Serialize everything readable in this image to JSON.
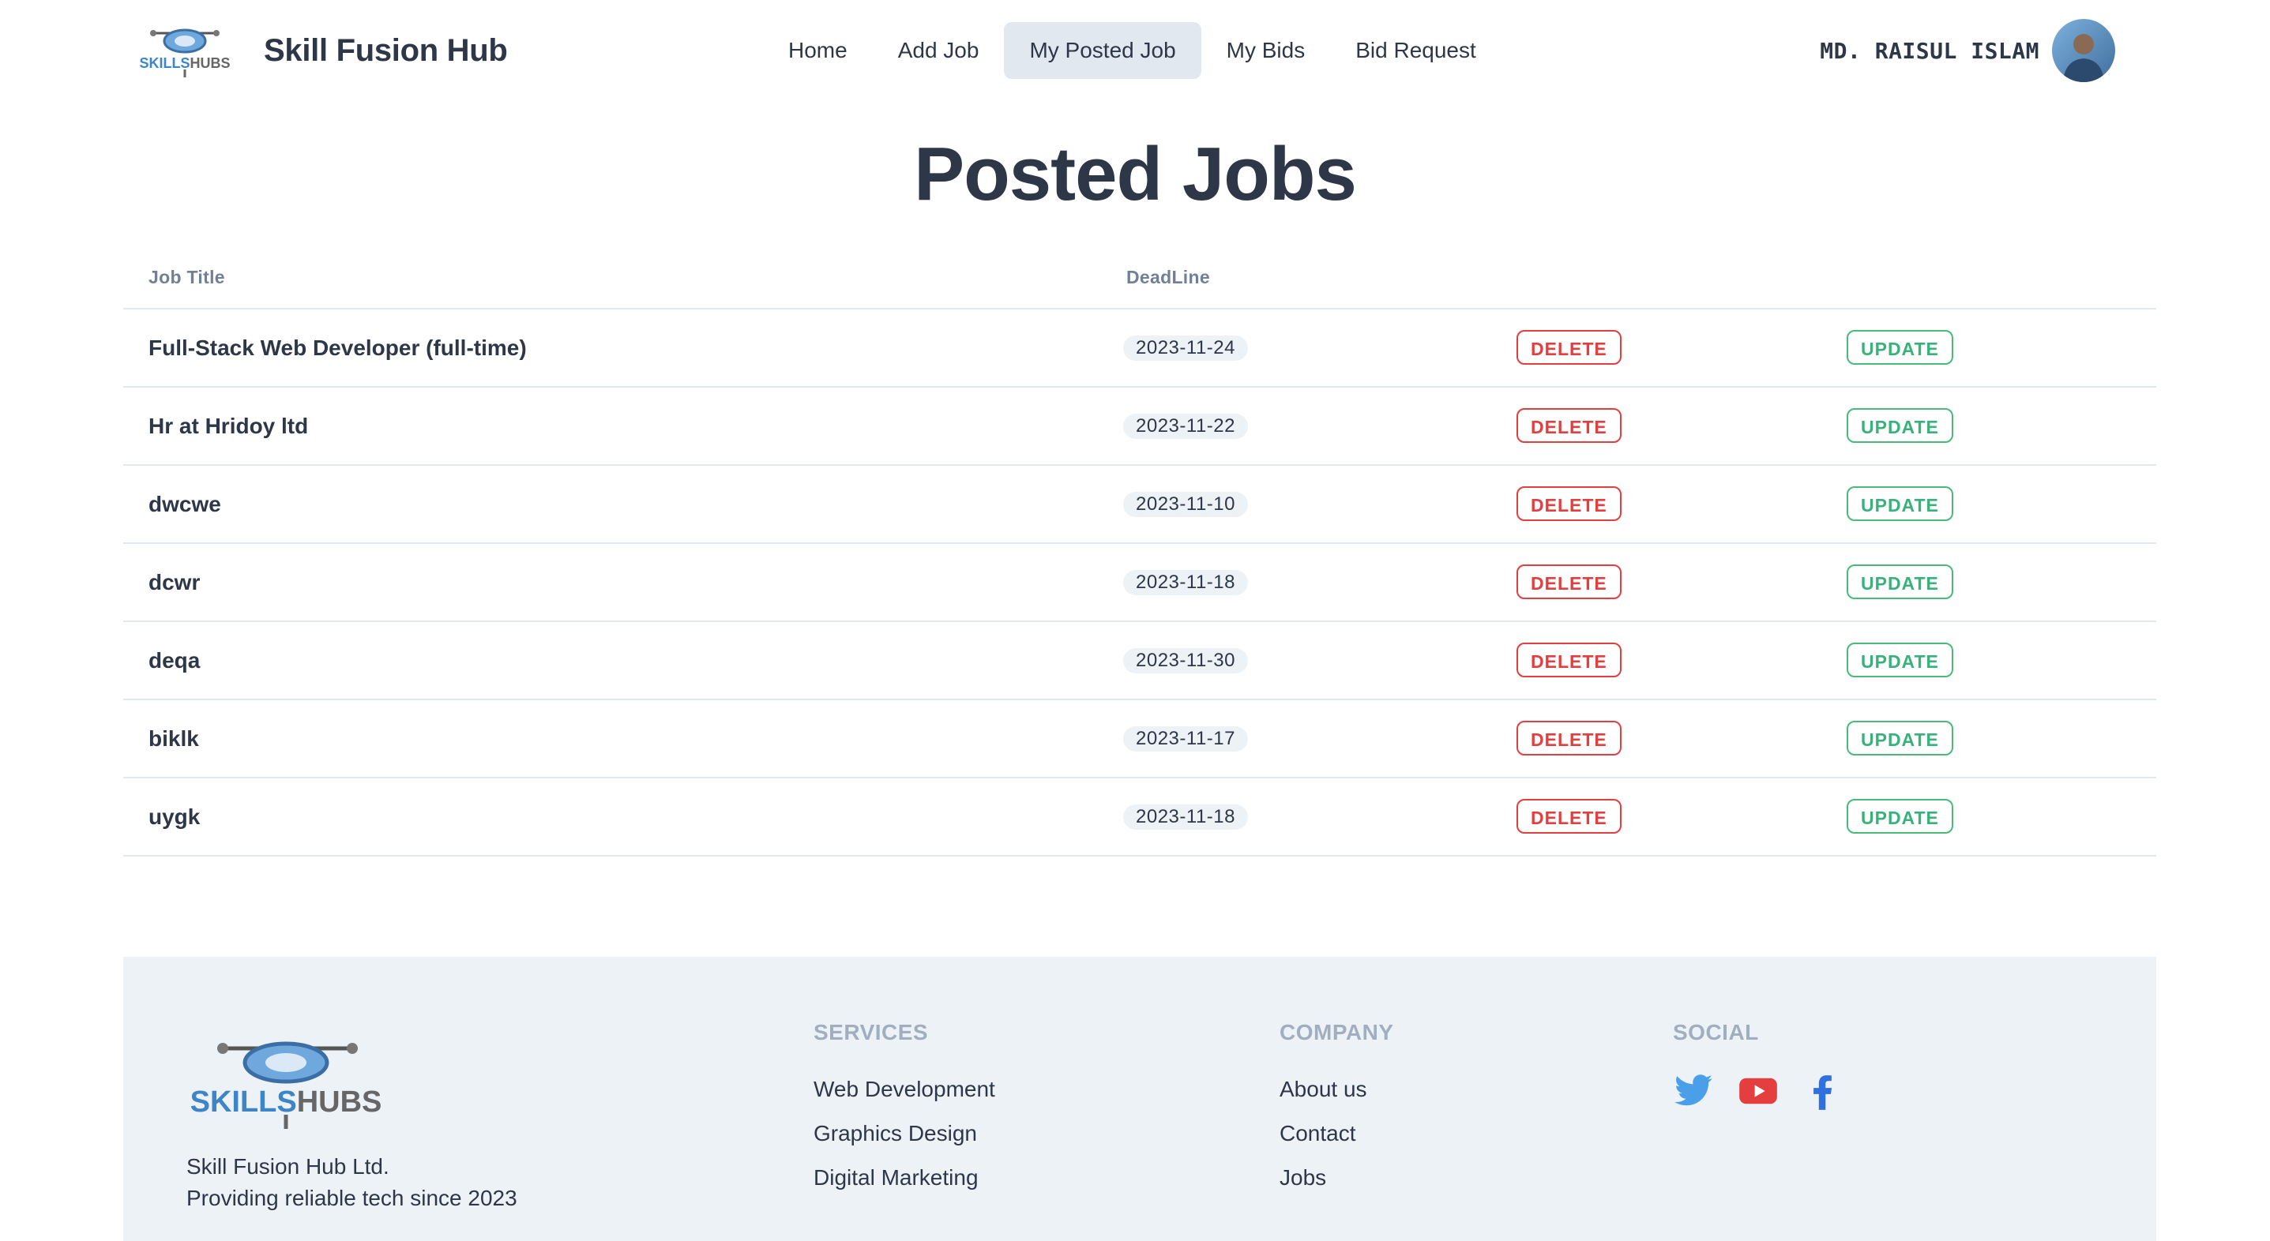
{
  "header": {
    "brand_name": "Skill Fusion Hub",
    "logo_text_skills": "SKILLS",
    "logo_text_hubs": "HUBS",
    "nav": [
      {
        "label": "Home"
      },
      {
        "label": "Add Job"
      },
      {
        "label": "My Posted Job",
        "active": true
      },
      {
        "label": "My Bids"
      },
      {
        "label": "Bid Request"
      }
    ],
    "user_name": "MD. RAISUL ISLAM",
    "avatar_icon": "user-avatar"
  },
  "main": {
    "title": "Posted Jobs",
    "table": {
      "columns": [
        "Job Title",
        "DeadLine"
      ],
      "rows": [
        {
          "title": "Full-Stack Web Developer (full-time)",
          "deadline": "2023-11-24",
          "delete_label": "DELETE",
          "update_label": "UPDATE"
        },
        {
          "title": "Hr at Hridoy ltd",
          "deadline": "2023-11-22",
          "delete_label": "DELETE",
          "update_label": "UPDATE"
        },
        {
          "title": "dwcwe",
          "deadline": "2023-11-10",
          "delete_label": "DELETE",
          "update_label": "UPDATE"
        },
        {
          "title": "dcwr",
          "deadline": "2023-11-18",
          "delete_label": "DELETE",
          "update_label": "UPDATE"
        },
        {
          "title": "deqa",
          "deadline": "2023-11-30",
          "delete_label": "DELETE",
          "update_label": "UPDATE"
        },
        {
          "title": "biklk",
          "deadline": "2023-11-17",
          "delete_label": "DELETE",
          "update_label": "UPDATE"
        },
        {
          "title": "uygk",
          "deadline": "2023-11-18",
          "delete_label": "DELETE",
          "update_label": "UPDATE"
        }
      ]
    }
  },
  "footer": {
    "company_name": "Skill Fusion Hub Ltd.",
    "tagline": "Providing reliable tech since 2023",
    "services": {
      "heading": "SERVICES",
      "links": [
        "Web Development",
        "Graphics Design",
        "Digital Marketing"
      ]
    },
    "company": {
      "heading": "COMPANY",
      "links": [
        "About us",
        "Contact",
        "Jobs"
      ]
    },
    "social": {
      "heading": "SOCIAL",
      "icons": [
        "twitter-icon",
        "youtube-icon",
        "facebook-icon"
      ]
    }
  },
  "colors": {
    "text": "#2d3748",
    "muted": "#718096",
    "delete": "#e53e3e",
    "update": "#48bb78",
    "footer_bg": "#edf2f7",
    "nav_active_bg": "#e2e8f0"
  }
}
